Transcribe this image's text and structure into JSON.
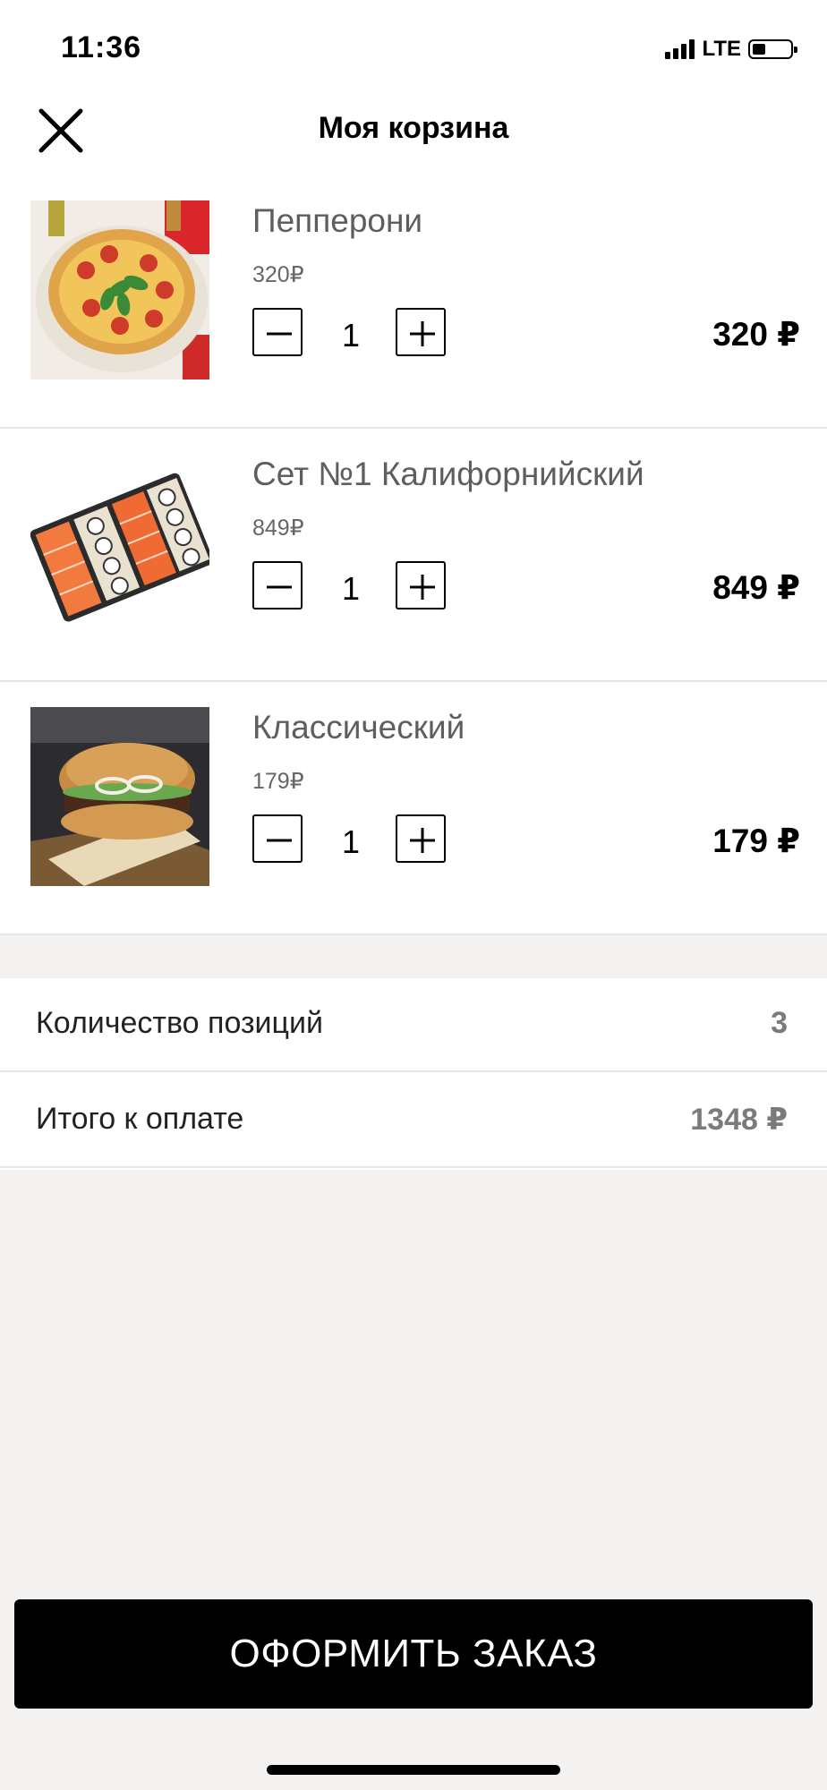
{
  "status_bar": {
    "time": "11:36",
    "network": "LTE"
  },
  "header": {
    "title": "Моя корзина",
    "close_icon": "close-icon"
  },
  "cart": {
    "items": [
      {
        "name": "Пепперони",
        "unit_price": "320₽",
        "quantity": "1",
        "total": "320 ₽",
        "image": "pepperoni-pizza"
      },
      {
        "name": "Сет №1 Калифорнийский",
        "unit_price": "849₽",
        "quantity": "1",
        "total": "849 ₽",
        "image": "sushi-set"
      },
      {
        "name": "Классический",
        "unit_price": "179₽",
        "quantity": "1",
        "total": "179 ₽",
        "image": "burger"
      }
    ],
    "decrement_icon": "minus-icon",
    "increment_icon": "plus-icon"
  },
  "summary": {
    "items_count_label": "Количество позиций",
    "items_count_value": "3",
    "total_label": "Итого к оплате",
    "total_value": "1348 ₽"
  },
  "checkout": {
    "label": "ОФОРМИТЬ ЗАКАЗ"
  },
  "colors": {
    "background": "#f4f2f1",
    "surface": "#ffffff",
    "accent": "#000000",
    "muted_text": "#5e5e5e"
  }
}
